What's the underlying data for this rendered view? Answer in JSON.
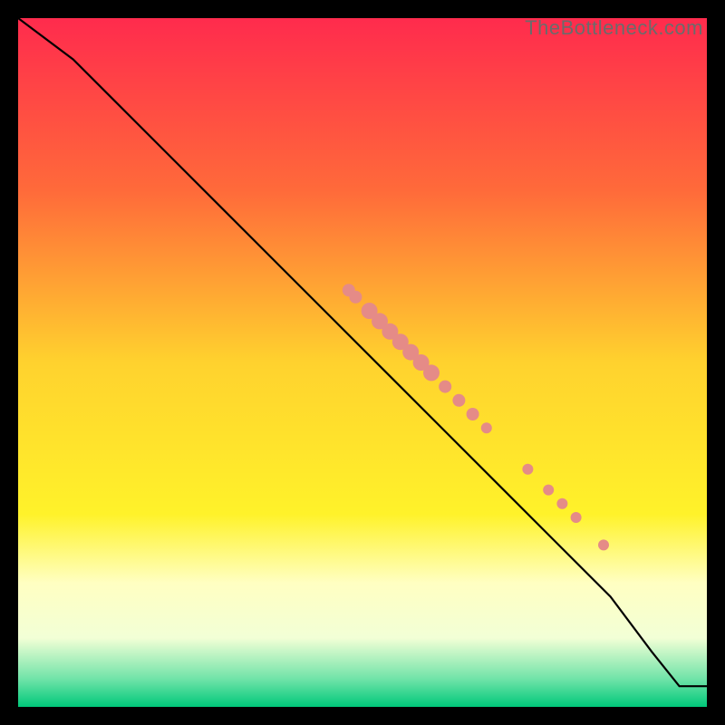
{
  "watermark": "TheBottleneck.com",
  "chart_data": {
    "type": "line",
    "title": "",
    "xlabel": "",
    "ylabel": "",
    "xlim": [
      0,
      100
    ],
    "ylim": [
      0,
      100
    ],
    "background_gradient": {
      "stops": [
        {
          "offset": 0.0,
          "color": "#ff2b4d"
        },
        {
          "offset": 0.25,
          "color": "#ff6a3a"
        },
        {
          "offset": 0.5,
          "color": "#ffd22e"
        },
        {
          "offset": 0.72,
          "color": "#fff22a"
        },
        {
          "offset": 0.82,
          "color": "#ffffc2"
        },
        {
          "offset": 0.9,
          "color": "#f2ffd6"
        },
        {
          "offset": 0.96,
          "color": "#6fe3a8"
        },
        {
          "offset": 1.0,
          "color": "#00c87a"
        }
      ]
    },
    "curve": [
      {
        "x": 0,
        "y": 100
      },
      {
        "x": 8,
        "y": 94
      },
      {
        "x": 14,
        "y": 88
      },
      {
        "x": 22,
        "y": 80
      },
      {
        "x": 30,
        "y": 72
      },
      {
        "x": 38,
        "y": 64
      },
      {
        "x": 46,
        "y": 56
      },
      {
        "x": 54,
        "y": 48
      },
      {
        "x": 62,
        "y": 40
      },
      {
        "x": 70,
        "y": 32
      },
      {
        "x": 78,
        "y": 24
      },
      {
        "x": 86,
        "y": 16
      },
      {
        "x": 92,
        "y": 8
      },
      {
        "x": 96,
        "y": 3
      },
      {
        "x": 100,
        "y": 3
      }
    ],
    "series": [
      {
        "name": "highlighted-points",
        "color": "#e58b87",
        "points": [
          {
            "x": 48,
            "y": 60.5,
            "r": 7
          },
          {
            "x": 49,
            "y": 59.5,
            "r": 7
          },
          {
            "x": 51,
            "y": 57.5,
            "r": 9
          },
          {
            "x": 52.5,
            "y": 56.0,
            "r": 9
          },
          {
            "x": 54,
            "y": 54.5,
            "r": 9
          },
          {
            "x": 55.5,
            "y": 53.0,
            "r": 9
          },
          {
            "x": 57,
            "y": 51.5,
            "r": 9
          },
          {
            "x": 58.5,
            "y": 50.0,
            "r": 9
          },
          {
            "x": 60,
            "y": 48.5,
            "r": 9
          },
          {
            "x": 62,
            "y": 46.5,
            "r": 7
          },
          {
            "x": 64,
            "y": 44.5,
            "r": 7
          },
          {
            "x": 66,
            "y": 42.5,
            "r": 7
          },
          {
            "x": 68,
            "y": 40.5,
            "r": 6
          },
          {
            "x": 74,
            "y": 34.5,
            "r": 6
          },
          {
            "x": 77,
            "y": 31.5,
            "r": 6
          },
          {
            "x": 79,
            "y": 29.5,
            "r": 6
          },
          {
            "x": 81,
            "y": 27.5,
            "r": 6
          },
          {
            "x": 85,
            "y": 23.5,
            "r": 6
          }
        ]
      }
    ]
  }
}
